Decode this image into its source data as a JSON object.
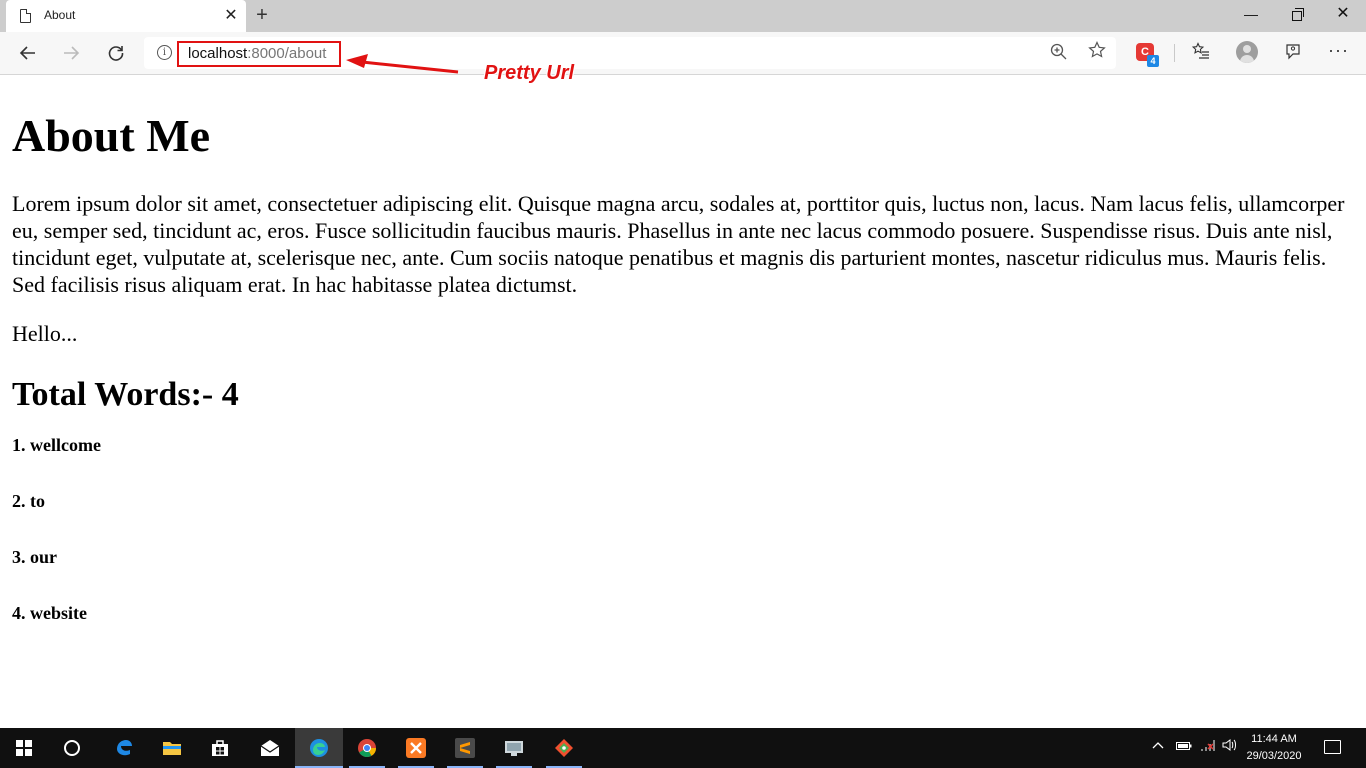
{
  "browser": {
    "tab_title": "About",
    "tab_close": "✕",
    "new_tab": "+",
    "window_buttons": {
      "minimize": "—",
      "close": "✕"
    },
    "url_host": "localhost",
    "url_path": ":8000/about",
    "extension_badge": "4"
  },
  "annotation": {
    "label": "Pretty Url",
    "color": "#e11212"
  },
  "page": {
    "heading": "About Me",
    "paragraph": "Lorem ipsum dolor sit amet, consectetuer adipiscing elit. Quisque magna arcu, sodales at, porttitor quis, luctus non, lacus. Nam lacus felis, ullamcorper eu, semper sed, tincidunt ac, eros. Fusce sollicitudin faucibus mauris. Phasellus in ante nec lacus commodo posuere. Suspendisse risus. Duis ante nisl, tincidunt eget, vulputate at, scelerisque nec, ante. Cum sociis natoque penatibus et magnis dis parturient montes, nascetur ridiculus mus. Mauris felis. Sed facilisis risus aliquam erat. In hac habitasse platea dictumst.",
    "greeting": "Hello...",
    "total_words_heading": "Total Words:- 4",
    "words": [
      "1. wellcome",
      "2. to",
      "3. our",
      "4. website"
    ]
  },
  "taskbar": {
    "clock_time": "11:44 AM",
    "clock_date": "29/03/2020"
  }
}
